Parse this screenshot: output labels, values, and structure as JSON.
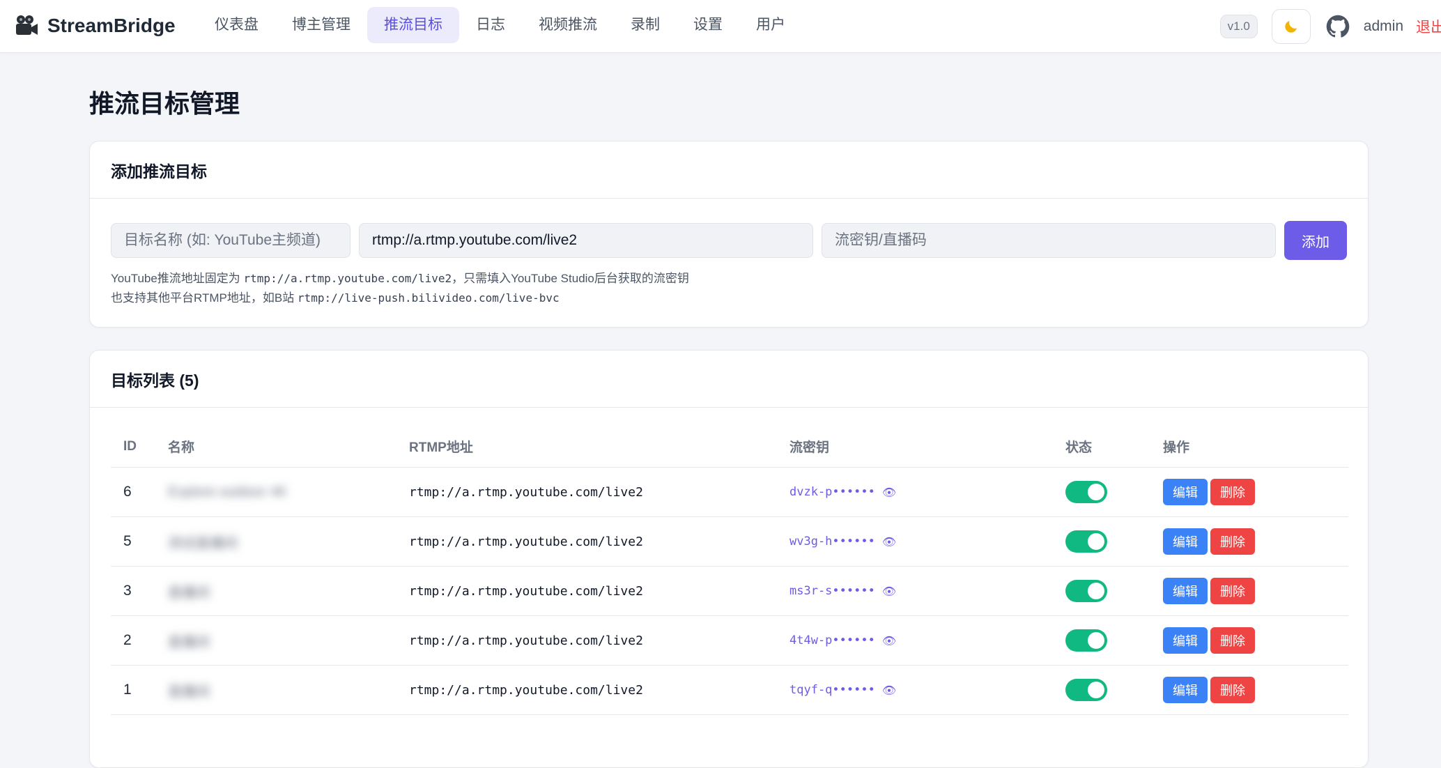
{
  "brand": {
    "name": "StreamBridge",
    "icon": "film-camera-icon"
  },
  "nav": [
    {
      "label": "仪表盘",
      "active": false
    },
    {
      "label": "博主管理",
      "active": false
    },
    {
      "label": "推流目标",
      "active": true
    },
    {
      "label": "日志",
      "active": false
    },
    {
      "label": "视频推流",
      "active": false
    },
    {
      "label": "录制",
      "active": false
    },
    {
      "label": "设置",
      "active": false
    },
    {
      "label": "用户",
      "active": false
    }
  ],
  "header_right": {
    "version": "v1.0",
    "theme_icon": "moon-icon",
    "github_icon": "github-icon",
    "user": "admin",
    "logout": "退出"
  },
  "page": {
    "title": "推流目标管理"
  },
  "add_form": {
    "title": "添加推流目标",
    "name_placeholder": "目标名称 (如: YouTube主频道)",
    "url_value": "rtmp://a.rtmp.youtube.com/live2",
    "key_placeholder": "流密钥/直播码",
    "add_label": "添加",
    "hint1_prefix": "YouTube推流地址固定为 ",
    "hint1_code": "rtmp://a.rtmp.youtube.com/live2",
    "hint1_suffix": "，只需填入YouTube Studio后台获取的流密钥",
    "hint2_prefix": "也支持其他平台RTMP地址，如B站 ",
    "hint2_code": "rtmp://live-push.bilivideo.com/live-bvc"
  },
  "list": {
    "title": "目标列表 (5)",
    "columns": {
      "id": "ID",
      "name": "名称",
      "url": "RTMP地址",
      "key": "流密钥",
      "status": "状态",
      "ops": "操作"
    },
    "edit_label": "编辑",
    "delete_label": "删除",
    "rows": [
      {
        "id": "6",
        "name": "Explore outdoor 4K",
        "url": "rtmp://a.rtmp.youtube.com/live2",
        "key": "dvzk-p••••••",
        "enabled": true
      },
      {
        "id": "5",
        "name": "测试直播间",
        "url": "rtmp://a.rtmp.youtube.com/live2",
        "key": "wv3g-h••••••",
        "enabled": true
      },
      {
        "id": "3",
        "name": "直播间",
        "url": "rtmp://a.rtmp.youtube.com/live2",
        "key": "ms3r-s••••••",
        "enabled": true
      },
      {
        "id": "2",
        "name": "直播间",
        "url": "rtmp://a.rtmp.youtube.com/live2",
        "key": "4t4w-p••••••",
        "enabled": true
      },
      {
        "id": "1",
        "name": "直播间",
        "url": "rtmp://a.rtmp.youtube.com/live2",
        "key": "tqyf-q••••••",
        "enabled": true
      }
    ]
  }
}
